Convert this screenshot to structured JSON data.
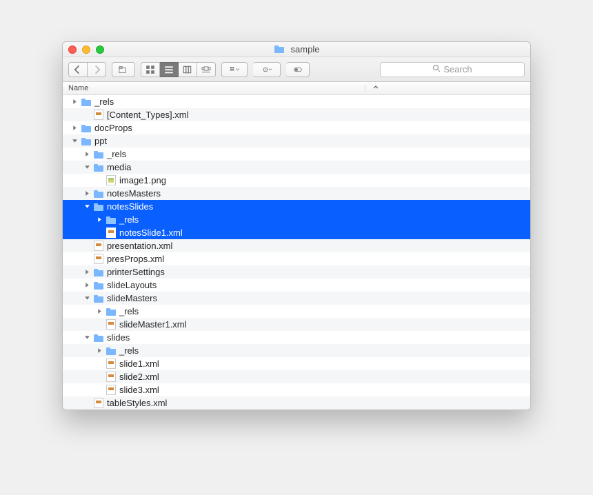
{
  "window": {
    "title": "sample"
  },
  "search": {
    "placeholder": "Search"
  },
  "columns": {
    "name": "Name"
  },
  "rows": [
    {
      "depth": 0,
      "disclosure": "closed",
      "icon": "folder",
      "label": "_rels",
      "selected": false
    },
    {
      "depth": 1,
      "disclosure": "none",
      "icon": "xml",
      "label": "[Content_Types].xml",
      "selected": false
    },
    {
      "depth": 0,
      "disclosure": "closed",
      "icon": "folder",
      "label": "docProps",
      "selected": false
    },
    {
      "depth": 0,
      "disclosure": "open",
      "icon": "folder",
      "label": "ppt",
      "selected": false
    },
    {
      "depth": 1,
      "disclosure": "closed",
      "icon": "folder",
      "label": "_rels",
      "selected": false
    },
    {
      "depth": 1,
      "disclosure": "open",
      "icon": "folder",
      "label": "media",
      "selected": false
    },
    {
      "depth": 2,
      "disclosure": "none",
      "icon": "png",
      "label": "image1.png",
      "selected": false
    },
    {
      "depth": 1,
      "disclosure": "closed",
      "icon": "folder",
      "label": "notesMasters",
      "selected": false
    },
    {
      "depth": 1,
      "disclosure": "open",
      "icon": "folder",
      "label": "notesSlides",
      "selected": true
    },
    {
      "depth": 2,
      "disclosure": "closed",
      "icon": "folder",
      "label": "_rels",
      "selected": true
    },
    {
      "depth": 2,
      "disclosure": "none",
      "icon": "xml",
      "label": "notesSlide1.xml",
      "selected": true
    },
    {
      "depth": 1,
      "disclosure": "none",
      "icon": "xml",
      "label": "presentation.xml",
      "selected": false
    },
    {
      "depth": 1,
      "disclosure": "none",
      "icon": "xml",
      "label": "presProps.xml",
      "selected": false
    },
    {
      "depth": 1,
      "disclosure": "closed",
      "icon": "folder",
      "label": "printerSettings",
      "selected": false
    },
    {
      "depth": 1,
      "disclosure": "closed",
      "icon": "folder",
      "label": "slideLayouts",
      "selected": false
    },
    {
      "depth": 1,
      "disclosure": "open",
      "icon": "folder",
      "label": "slideMasters",
      "selected": false
    },
    {
      "depth": 2,
      "disclosure": "closed",
      "icon": "folder",
      "label": "_rels",
      "selected": false
    },
    {
      "depth": 2,
      "disclosure": "none",
      "icon": "xml",
      "label": "slideMaster1.xml",
      "selected": false
    },
    {
      "depth": 1,
      "disclosure": "open",
      "icon": "folder",
      "label": "slides",
      "selected": false
    },
    {
      "depth": 2,
      "disclosure": "closed",
      "icon": "folder",
      "label": "_rels",
      "selected": false
    },
    {
      "depth": 2,
      "disclosure": "none",
      "icon": "xml",
      "label": "slide1.xml",
      "selected": false
    },
    {
      "depth": 2,
      "disclosure": "none",
      "icon": "xml",
      "label": "slide2.xml",
      "selected": false
    },
    {
      "depth": 2,
      "disclosure": "none",
      "icon": "xml",
      "label": "slide3.xml",
      "selected": false
    },
    {
      "depth": 1,
      "disclosure": "none",
      "icon": "xml",
      "label": "tableStyles.xml",
      "selected": false
    }
  ]
}
